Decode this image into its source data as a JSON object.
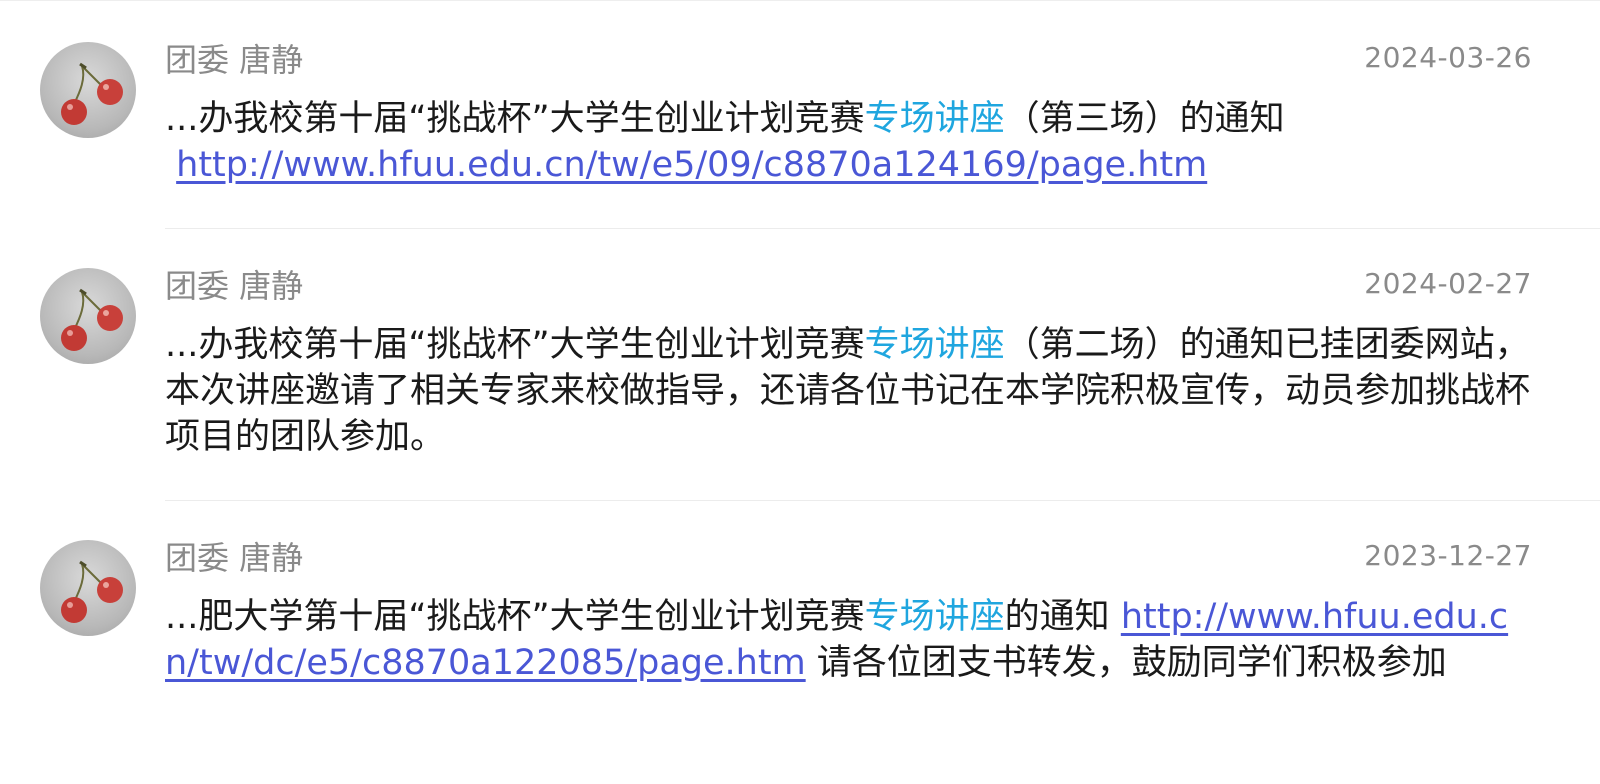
{
  "results": [
    {
      "sender": "团委 唐静",
      "date": "2024-03-26",
      "parts": {
        "pre": "...办我校第十届“挑战杯”大学生创业计划竞赛",
        "highlight": "专场讲座",
        "mid": "（第三场）的通知",
        "link": "http://www.hfuu.edu.cn/tw/e5/09/c8870a124169/page.htm",
        "post": ""
      }
    },
    {
      "sender": "团委 唐静",
      "date": "2024-02-27",
      "parts": {
        "pre": "...办我校第十届“挑战杯”大学生创业计划竞赛",
        "highlight": "专场讲座",
        "mid": "（第二场）的通知已挂团委网站，本次讲座邀请了相关专家来校做指导，还请各位书记在本学院积极宣传，动员参加挑战杯项目的团队参加。",
        "link": "",
        "post": ""
      }
    },
    {
      "sender": "团委 唐静",
      "date": "2023-12-27",
      "parts": {
        "pre": "...肥大学第十届“挑战杯”大学生创业计划竞赛",
        "highlight": "专场讲座",
        "mid": "的通知 ",
        "link": "http://www.hfuu.edu.cn/tw/dc/e5/c8870a122085/page.htm",
        "post": " 请各位团支书转发，鼓励同学们积极参加"
      }
    }
  ],
  "colors": {
    "highlight": "#1fa6df",
    "link": "#4a57d6",
    "meta_text": "#8a8a8a"
  },
  "icons": {
    "avatar": "cherry-avatar-icon"
  }
}
